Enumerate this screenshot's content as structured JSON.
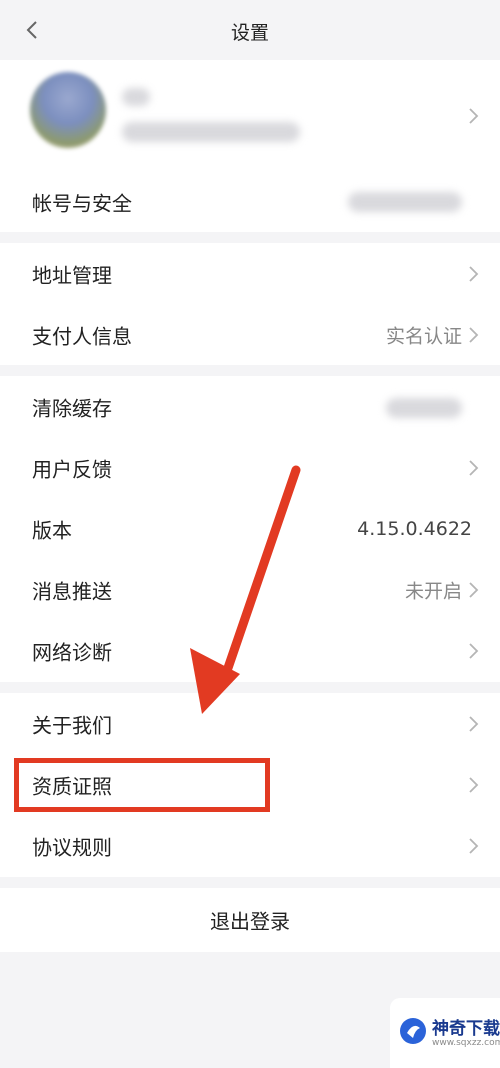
{
  "nav": {
    "title": "设置"
  },
  "groups": {
    "account": {
      "account_security": "帐号与安全"
    },
    "address": {
      "address_management": "地址管理",
      "payer_info": "支付人信息",
      "payer_info_value": "实名认证"
    },
    "system": {
      "clear_cache": "清除缓存",
      "feedback": "用户反馈",
      "version": "版本",
      "version_value": "4.15.0.4622",
      "push": "消息推送",
      "push_value": "未开启",
      "network": "网络诊断"
    },
    "about": {
      "about_us": "关于我们",
      "license": "资质证照",
      "agreement": "协议规则"
    }
  },
  "logout": {
    "label": "退出登录"
  },
  "watermark": {
    "name": "神奇下载",
    "url": "www.sqxzz.com"
  },
  "colors": {
    "annotation": "#e23a22",
    "background": "#f4f4f6"
  }
}
